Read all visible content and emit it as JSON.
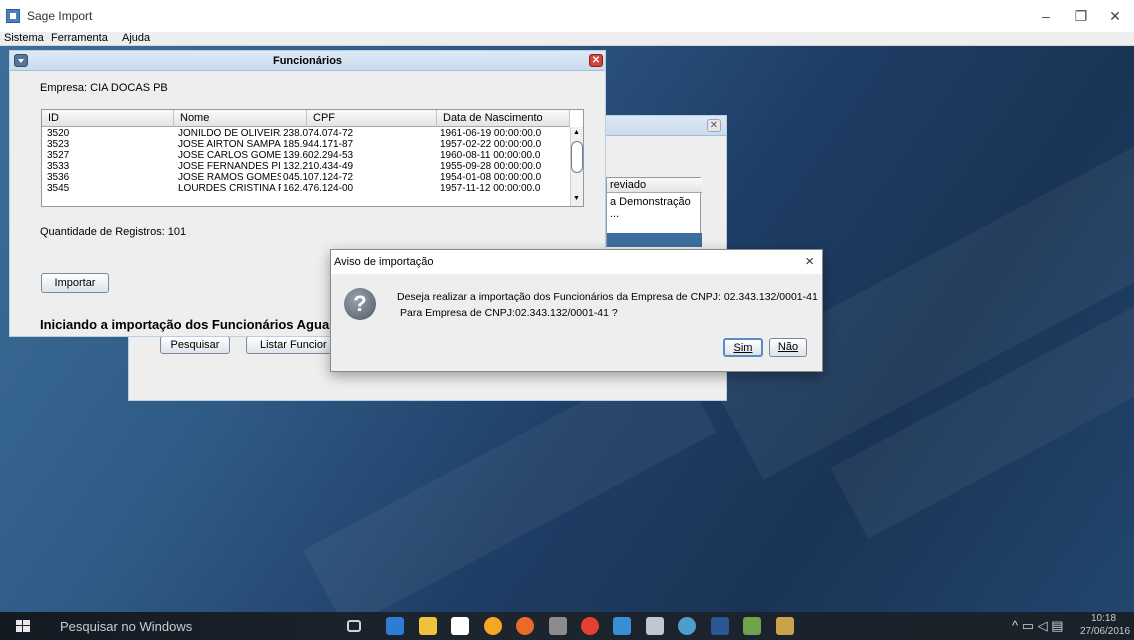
{
  "window": {
    "title": "Sage Import"
  },
  "menu": [
    "Sistema",
    "Ferramenta",
    "Ajuda"
  ],
  "frame_funcionarios": {
    "title": "Funcionários",
    "empresa_label": "Empresa: CIA DOCAS PB",
    "columns": [
      "ID",
      "Nome",
      "CPF",
      "Data de Nascimento"
    ],
    "rows": [
      [
        "3520",
        "JONILDO DE OLIVEIRA ...",
        "238.074.074-72",
        "1961-06-19 00:00:00.0"
      ],
      [
        "3523",
        "JOSE AIRTON SAMPAIO",
        "185.944.171-87",
        "1957-02-22 00:00:00.0"
      ],
      [
        "3527",
        "JOSE CARLOS GOMES F...",
        "139.602.294-53",
        "1960-08-11 00:00:00.0"
      ],
      [
        "3533",
        "JOSE FERNANDES PINTO",
        "132.210.434-49",
        "1955-09-28 00:00:00.0"
      ],
      [
        "3536",
        "JOSÉ RAMOS GOMES VI...",
        "045.107.124-72",
        "1954-01-08 00:00:00.0"
      ],
      [
        "3545",
        "LOURDES CRISTINA P. ...",
        "162.476.124-00",
        "1957-11-12 00:00:00.0"
      ]
    ],
    "quantidade": "Quantidade de Registros: 101",
    "importar_label": "Importar",
    "status_text": "Iniciando a importação dos Funcionários Aguarde ."
  },
  "back_frame": {
    "column_partial": "reviado",
    "cell_partial": "a Demonstração ...",
    "pesquisar_label": "Pesquisar",
    "listar_label": "Listar Funcior"
  },
  "dialog": {
    "title": "Aviso de importação",
    "close": "×",
    "message_line1": "Deseja realizar a importação dos Funcionários da Empresa de CNPJ: 02.343.132/0001-41",
    "message_line2": "Para Empresa de CNPJ:02.343.132/0001-41 ?",
    "yes_label": "Sim",
    "no_label": "Não",
    "icon": "question-icon"
  },
  "taskbar": {
    "search_placeholder": "Pesquisar no Windows",
    "time": "10:18",
    "date": "27/06/2016"
  }
}
